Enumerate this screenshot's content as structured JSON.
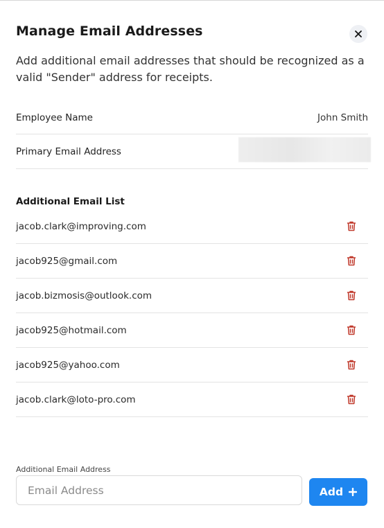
{
  "modal": {
    "title": "Manage Email Addresses",
    "description": "Add additional email addresses that should be recognized as a valid \"Sender\" address for receipts."
  },
  "employee": {
    "name_label": "Employee Name",
    "name_value": "John Smith",
    "primary_email_label": "Primary Email Address"
  },
  "additional": {
    "title": "Additional Email List",
    "emails": [
      "jacob.clark@improving.com",
      "jacob925@gmail.com",
      "jacob.bizmosis@outlook.com",
      "jacob925@hotmail.com",
      "jacob925@yahoo.com",
      "jacob.clark@loto-pro.com"
    ]
  },
  "form": {
    "label": "Additional Email Address",
    "placeholder": "Email Address",
    "value": "",
    "add_label": "Add"
  },
  "colors": {
    "accent": "#1e86f0",
    "danger": "#c0392b"
  },
  "icons": {
    "close": "close-icon",
    "delete": "trash-icon",
    "add": "plus-icon"
  }
}
